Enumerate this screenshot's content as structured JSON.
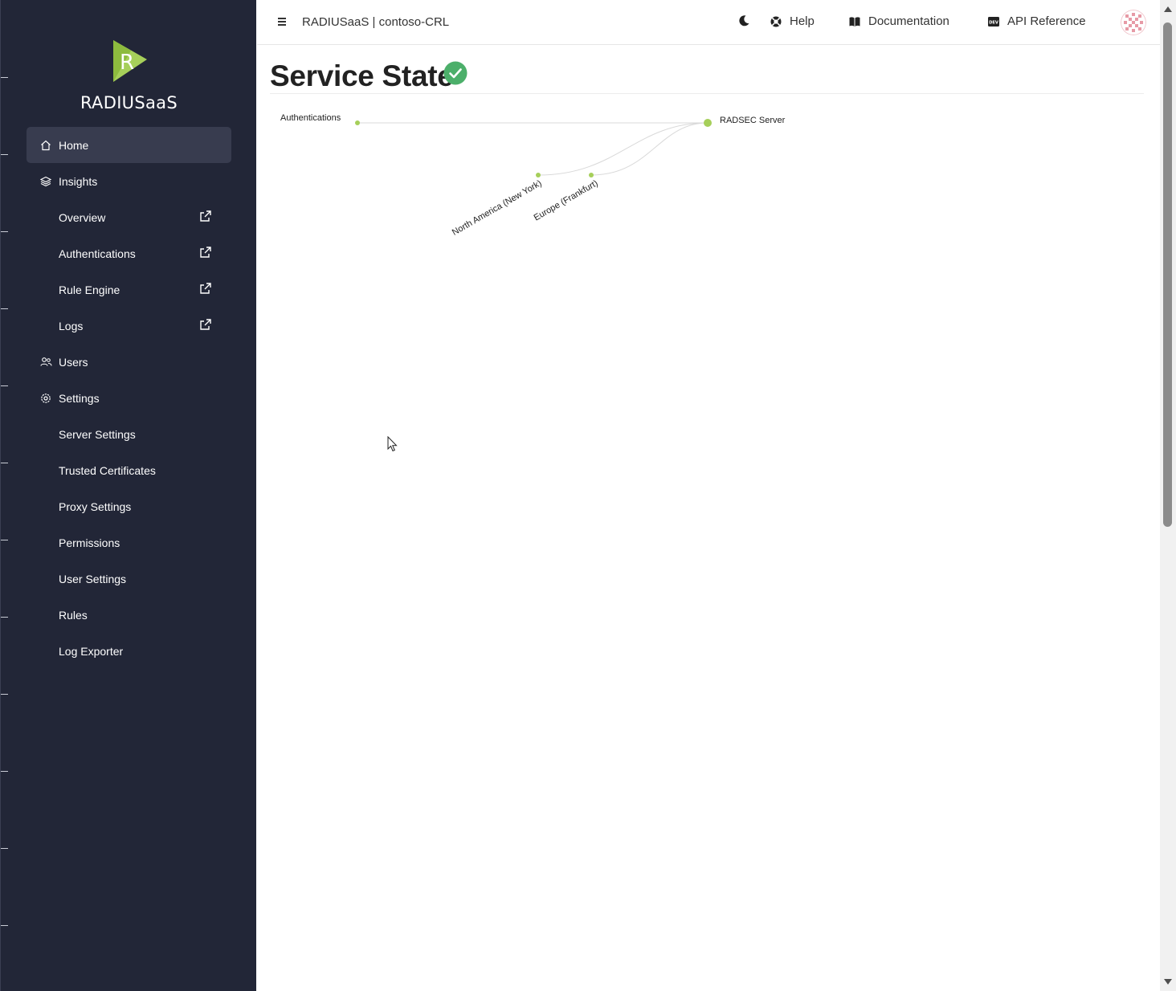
{
  "brand": {
    "name": "RADIUSaaS",
    "logo_letter": "R",
    "logo_color": "#a6cf5a"
  },
  "sidebar": {
    "items": [
      {
        "label": "Home",
        "icon": "home-icon",
        "active": true
      },
      {
        "label": "Insights",
        "icon": "layers-icon"
      },
      {
        "label": "Overview",
        "external": true
      },
      {
        "label": "Authentications",
        "external": true
      },
      {
        "label": "Rule Engine",
        "external": true
      },
      {
        "label": "Logs",
        "external": true
      },
      {
        "label": "Users",
        "icon": "users-icon"
      },
      {
        "label": "Settings",
        "icon": "gear-icon"
      },
      {
        "label": "Server Settings"
      },
      {
        "label": "Trusted Certificates"
      },
      {
        "label": "Proxy Settings"
      },
      {
        "label": "Permissions"
      },
      {
        "label": "User Settings"
      },
      {
        "label": "Rules"
      },
      {
        "label": "Log Exporter"
      }
    ]
  },
  "topbar": {
    "title": "RADIUSaaS | contoso-CRL",
    "theme_toggle_icon": "moon-icon",
    "help": "Help",
    "documentation": "Documentation",
    "api_reference": "API Reference"
  },
  "main": {
    "title": "Service State",
    "status": "ok",
    "status_color": "#4caf6a"
  },
  "graph": {
    "source_node": "Authentications",
    "target_node": "RADSEC Server",
    "regions": [
      "North America (New York)",
      "Europe (Frankfurt)"
    ],
    "node_color": "#a6cf5a",
    "link_color": "#d9d9d9"
  }
}
